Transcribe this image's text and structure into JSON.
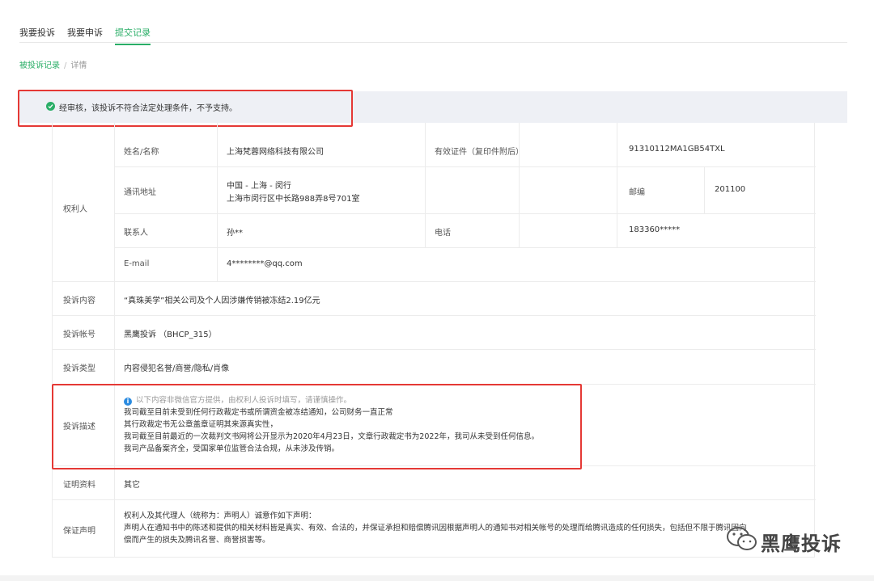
{
  "tabs": [
    {
      "label": "我要投诉"
    },
    {
      "label": "我要申诉"
    },
    {
      "label": "提交记录"
    }
  ],
  "breadcrumb": {
    "parent": "被投诉记录",
    "separator": "/",
    "current": "详情"
  },
  "notice": {
    "text": "经审核，该投诉不符合法定处理条件，不予支持。"
  },
  "rights_holder": {
    "section_label": "权利人",
    "name_label": "姓名/名称",
    "name_value": "上海梵蓉网络科技有限公司",
    "license_label": "有效证件（复印件附后）",
    "license_value": "91310112MA1GB54TXL",
    "address_label": "通讯地址",
    "address_line1": "中国 - 上海 - 闵行",
    "address_line2": "上海市闵行区中长路988弄8号701室",
    "postcode_label": "邮编",
    "postcode_value": "201100",
    "contact_label": "联系人",
    "contact_value": "孙**",
    "phone_label": "电话",
    "phone_value": "183360*****",
    "email_label": "E-mail",
    "email_value": "4********@qq.com"
  },
  "complaint_content": {
    "label": "投诉内容",
    "value": "“真珠美学”相关公司及个人因涉嫌传销被冻结2.19亿元"
  },
  "complaint_account": {
    "label": "投诉帐号",
    "value": "黑鹰投诉 （BHCP_315）"
  },
  "complaint_type": {
    "label": "投诉类型",
    "value": "内容侵犯名誉/商誉/隐私/肖像"
  },
  "complaint_desc": {
    "label": "投诉描述",
    "disclaimer": "以下内容非微信官方提供，由权利人投诉时填写，请谨慎操作。",
    "lines": [
      "我司截至目前未受到任何行政裁定书或所谓资金被冻结通知，公司财务一直正常",
      "其行政裁定书无公章盖章证明其来源真实性，",
      "我司截至目前最近的一次裁判文书网将公开显示为2020年4月23日，文章行政裁定书为2022年，我司从未受到任何信息。",
      "我司产品备案齐全，受国家单位监管合法合规，从未涉及传销。"
    ]
  },
  "evidence": {
    "label": "证明资料",
    "value": "其它"
  },
  "guarantee": {
    "label": "保证声明",
    "lines": [
      "权利人及其代理人（统称为：声明人）诚意作如下声明：",
      "声明人在通知书中的陈述和提供的相关材料皆是真实、有效、合法的，并保证承担和赔偿腾讯因根据声明人的通知书对相关帐号的处理而给腾讯造成的任何损失，包括但不限于腾讯因向被投诉方或用户赔",
      "偿而产生的损失及腾讯名誉、商誉损害等。"
    ]
  },
  "watermark": {
    "text": "黑鹰投诉"
  },
  "colors": {
    "accent": "#2aae67",
    "highlight_box": "#e53935",
    "notice_bg": "#eef0f5",
    "info_icon": "#2b8be0"
  }
}
